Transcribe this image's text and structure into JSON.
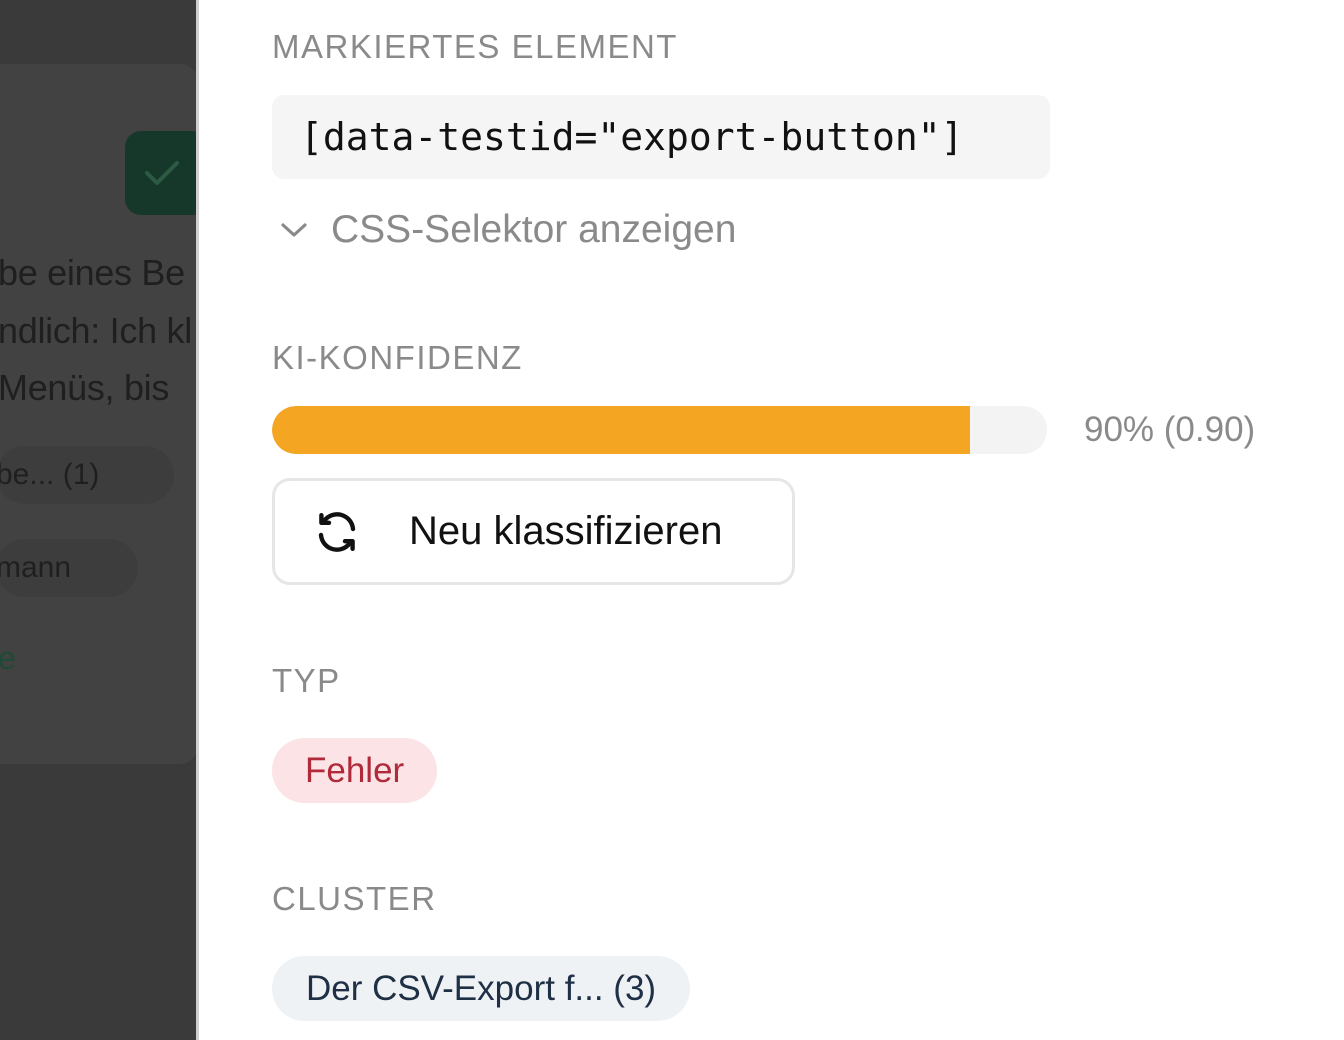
{
  "background": {
    "text_lines": [
      "be eines Be",
      "ndlich: Ich kl",
      " Menüs, bis"
    ],
    "pills": [
      "be... (1)",
      "mann"
    ],
    "link": "e"
  },
  "panel": {
    "marked_element": {
      "label": "MARKIERTES ELEMENT",
      "selector": "[data-testid=\"export-button\"]",
      "toggle_label": "CSS-Selektor anzeigen"
    },
    "confidence": {
      "label": "KI-KONFIDENZ",
      "percent": 90,
      "value_text": "90% (0.90)",
      "bar_color": "#f4a623"
    },
    "reclassify_button": {
      "label": "Neu klassifizieren",
      "icon": "refresh-icon"
    },
    "type": {
      "label": "TYP",
      "value": "Fehler",
      "badge_color": "#fbe3e6",
      "text_color": "#b02a3a"
    },
    "cluster": {
      "label": "CLUSTER",
      "value": "Der CSV-Export f... (3)"
    }
  }
}
